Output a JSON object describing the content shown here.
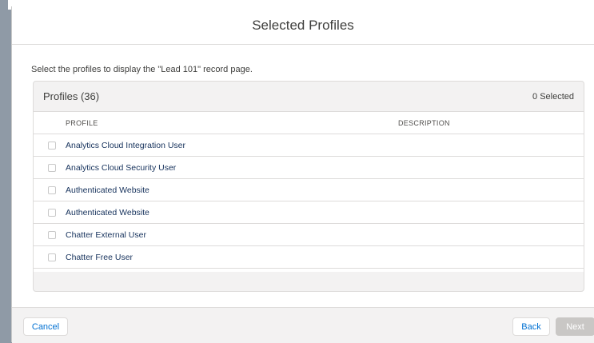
{
  "modal": {
    "title": "Selected Profiles",
    "instructions": "Select the profiles to display the \"Lead 101\" record page."
  },
  "card": {
    "title": "Profiles (36)",
    "selected_count": "0 Selected"
  },
  "table": {
    "columns": [
      "PROFILE",
      "DESCRIPTION"
    ],
    "rows": [
      {
        "profile": "Analytics Cloud Integration User",
        "description": ""
      },
      {
        "profile": "Analytics Cloud Security User",
        "description": ""
      },
      {
        "profile": "Authenticated Website",
        "description": ""
      },
      {
        "profile": "Authenticated Website",
        "description": ""
      },
      {
        "profile": "Chatter External User",
        "description": ""
      },
      {
        "profile": "Chatter Free User",
        "description": ""
      }
    ]
  },
  "footer": {
    "cancel_label": "Cancel",
    "back_label": "Back",
    "next_label": "Next"
  },
  "colors": {
    "link": "#16325c",
    "brand": "#0070d2",
    "disabled": "#c9c7c5"
  }
}
